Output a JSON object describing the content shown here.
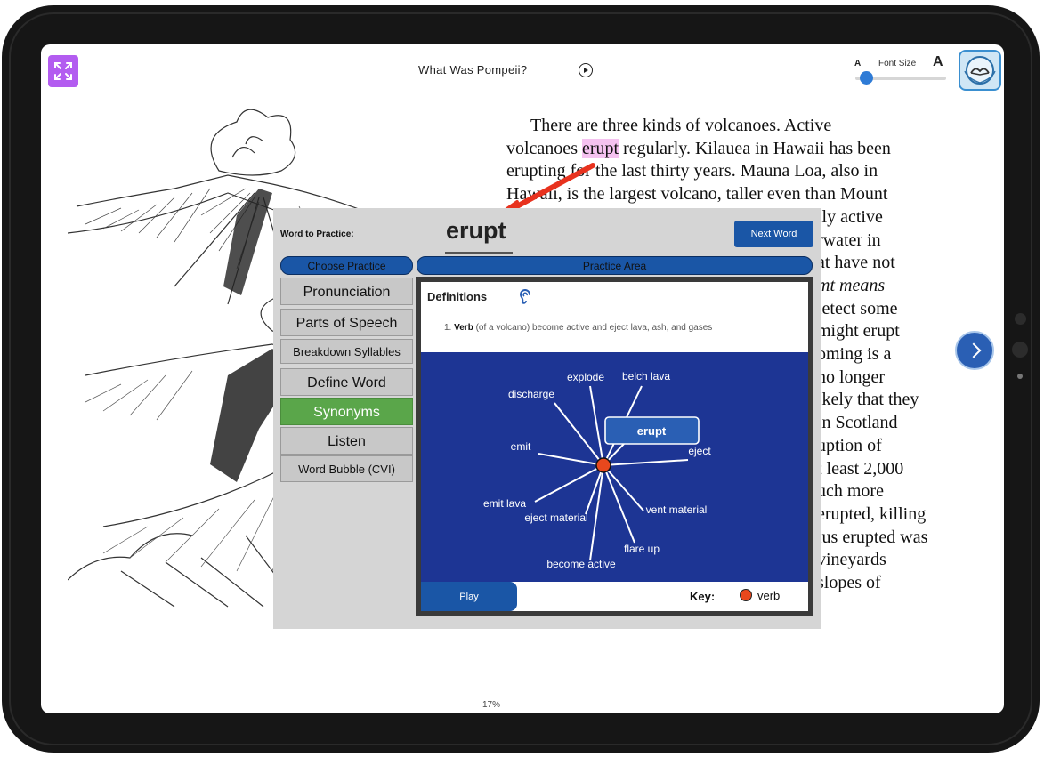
{
  "app": {
    "book_title": "What Was Pompeii?",
    "font_size": {
      "label": "Font Size",
      "small_glyph": "A",
      "large_glyph": "A",
      "level": 0.05
    },
    "progress": "17%",
    "icons": {
      "fullscreen": "expand-icon",
      "play_audio": "play-circle-icon",
      "next_page": "chevron-right-icon",
      "profile": "book-badge-icon"
    }
  },
  "page": {
    "lines": [
      {
        "before": "There are three kinds of volcanoes. Active",
        "hl": "",
        "after": ""
      },
      {
        "before": "volcanoes ",
        "hl": "erupt",
        "after": " regularly. Kilauea in Hawaii has been"
      },
      {
        "before": "erupting for the last thirty years. Mauna Loa, also in",
        "hl": "",
        "after": ""
      },
      {
        "before": "Hawaii, is the largest volcano, taller even than Mount",
        "hl": "",
        "after": ""
      },
      {
        "before": "lly active",
        "hl": "",
        "after": ""
      },
      {
        "before": "rwater in",
        "hl": "",
        "after": ""
      },
      {
        "before": "at have not",
        "hl": "",
        "after": ""
      },
      {
        "before": "mt means",
        "hl": "",
        "after": ""
      },
      {
        "before": "letect some",
        "hl": "",
        "after": ""
      },
      {
        "before": "might erupt",
        "hl": "",
        "after": ""
      },
      {
        "before": "oming is a",
        "hl": "",
        "after": ""
      },
      {
        "before": "no longer",
        "hl": "",
        "after": ""
      },
      {
        "before": "ikely that they",
        "hl": "",
        "after": ""
      },
      {
        "before": "in Scotland",
        "hl": "",
        "after": ""
      },
      {
        "before": "uption of",
        "hl": "",
        "after": ""
      },
      {
        "before": "t least 2,000",
        "hl": "",
        "after": ""
      },
      {
        "before": "uch more",
        "hl": "",
        "after": ""
      },
      {
        "before": "erupted, killing",
        "hl": "",
        "after": ""
      },
      {
        "before": "ius erupted was",
        "hl": "",
        "after": ""
      },
      {
        "before": "vineyards",
        "hl": "",
        "after": ""
      },
      {
        "before": "slopes of",
        "hl": "",
        "after": ""
      }
    ]
  },
  "popup": {
    "word_label": "Word to Practice:",
    "word": "erupt",
    "next_word": "Next Word",
    "choose_practice": "Choose Practice",
    "practice_area": "Practice Area",
    "menu": [
      {
        "label": "Pronunciation",
        "active": false
      },
      {
        "label": "Parts of Speech",
        "active": false
      },
      {
        "label": "Breakdown Syllables",
        "active": false
      },
      {
        "label": "Define Word",
        "active": false
      },
      {
        "label": "Synonyms",
        "active": true
      },
      {
        "label": "Listen",
        "active": false
      },
      {
        "label": "Word Bubble (CVI)",
        "active": false
      }
    ],
    "definitions_title": "Definitions",
    "definition": {
      "number": "1.",
      "pos": "Verb",
      "text": "(of a volcano) become active and eject lava, ash, and gases"
    },
    "synonym_map": {
      "center": "erupt",
      "synonyms": [
        "explode",
        "belch lava",
        "discharge",
        "emit",
        "eject",
        "emit lava",
        "eject material",
        "vent material",
        "flare up",
        "become active"
      ]
    },
    "play": "Play",
    "key": "Key:",
    "key_item": {
      "label": "verb",
      "color": "#e8481d"
    }
  },
  "colors": {
    "accent_blue": "#1a56a6",
    "active_green": "#5aa64a",
    "highlight_pink": "#f5c2f0",
    "map_bg": "#1d3594",
    "arrow_red": "#e8321e"
  }
}
